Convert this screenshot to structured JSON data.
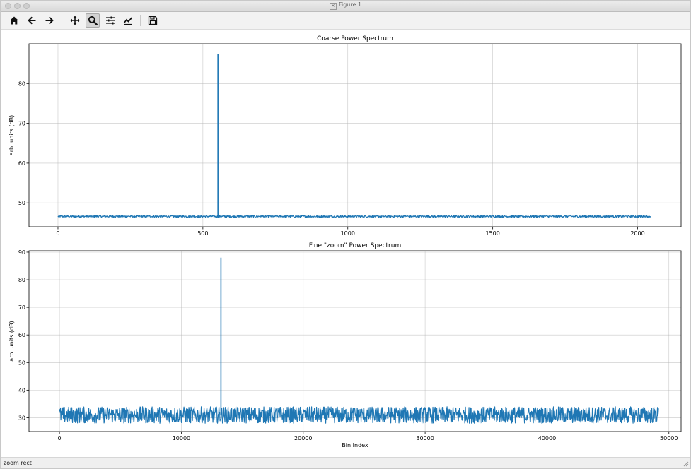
{
  "window": {
    "title": "Figure 1"
  },
  "toolbar": {
    "buttons": [
      {
        "icon": "home-icon"
      },
      {
        "icon": "back-arrow-icon"
      },
      {
        "icon": "forward-arrow-icon"
      },
      {
        "icon": "pan-icon"
      },
      {
        "icon": "zoom-icon",
        "active": true
      },
      {
        "icon": "configure-subplots-icon"
      },
      {
        "icon": "edit-axis-icon"
      },
      {
        "icon": "save-icon"
      }
    ]
  },
  "status": {
    "text": "zoom rect"
  },
  "colors": {
    "line": "#1f77b4",
    "grid": "#b0b0b0",
    "axis": "#000000"
  },
  "chart_data": [
    {
      "type": "line",
      "title": "Coarse Power Spectrum",
      "xlabel": "",
      "ylabel": "arb. units (dB)",
      "xlim": [
        -100,
        2150
      ],
      "ylim": [
        44,
        90
      ],
      "xticks": [
        0,
        500,
        1000,
        1500,
        2000
      ],
      "yticks": [
        50,
        60,
        70,
        80
      ],
      "grid": true,
      "series": [
        {
          "baseline": 46.6,
          "noise_amplitude": 0.25,
          "x_range": [
            0,
            2047
          ],
          "peak": {
            "x": 552,
            "y": 87.5
          }
        }
      ]
    },
    {
      "type": "line",
      "title": "Fine \"zoom\" Power Spectrum",
      "xlabel": "Bin Index",
      "ylabel": "arb. units (dB)",
      "xlim": [
        -2500,
        51000
      ],
      "ylim": [
        25,
        90.5
      ],
      "xticks": [
        0,
        10000,
        20000,
        30000,
        40000,
        50000
      ],
      "yticks": [
        30,
        40,
        50,
        60,
        70,
        80,
        90
      ],
      "grid": true,
      "series": [
        {
          "baseline": 31,
          "noise_amplitude": 3,
          "x_range": [
            0,
            49151
          ],
          "peak": {
            "x": 13250,
            "y": 88
          }
        }
      ]
    }
  ]
}
